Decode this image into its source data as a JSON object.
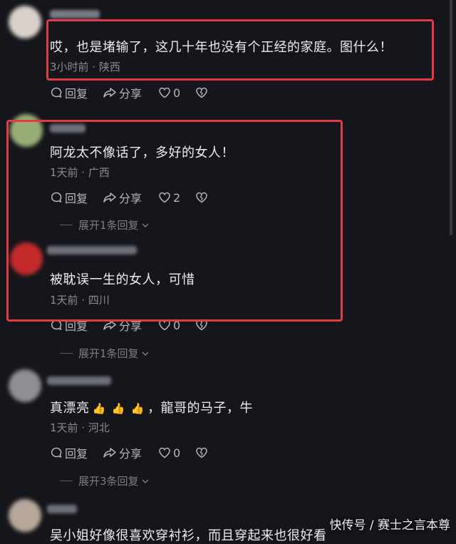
{
  "comments": [
    {
      "text": "哎，也是堵输了，这几十年也没有个正经的家庭。图什么！",
      "meta": "3小时前 · 陕西",
      "reply": "回复",
      "share": "分享",
      "likes": "0"
    },
    {
      "text": "阿龙太不像话了，多好的女人！",
      "meta": "1天前 · 广西",
      "reply": "回复",
      "share": "分享",
      "likes": "2",
      "expand": "展开1条回复"
    },
    {
      "text": "被耽误一生的女人，可惜",
      "meta": "1天前 · 四川",
      "reply": "回复",
      "share": "分享",
      "likes": "0",
      "expand": "展开1条回复"
    },
    {
      "text_a": "真漂亮",
      "text_b": "，龍哥的马子，牛",
      "meta": "1天前 · 河北",
      "reply": "回复",
      "share": "分享",
      "likes": "0",
      "expand": "展开3条回复"
    },
    {
      "text_partial": "吴小姐好像很喜欢穿衬衫，而且穿起来也很好看"
    }
  ],
  "watermark": "快传号 / 赛士之言本尊",
  "colors": {
    "background": "#15161c",
    "highlight_box": "#e43a45"
  }
}
